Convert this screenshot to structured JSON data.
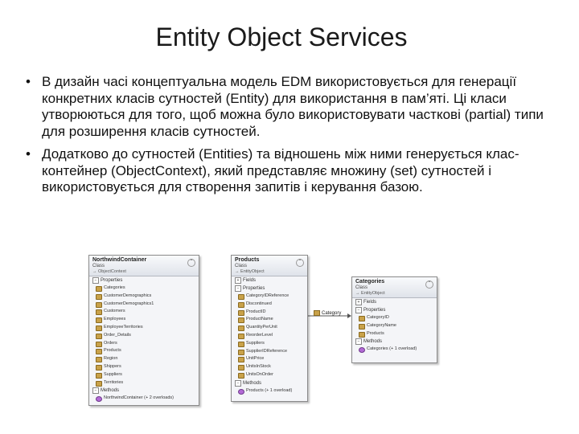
{
  "slide": {
    "title": "Entity Object Services",
    "bullets": [
      "В дизайн часі концептуальна модель EDM використовується для генерації конкретних класів сутностей (Entity) для використання в пам’яті. Ці класи утворюються для того, щоб можна було використовувати часткові (partial) типи для розширення класів сутностей.",
      "Додатково до сутностей (Entities)  та відношень між ними генерується клас-контейнер (ObjectContext), який представляє множину (set) сутностей і використовується для  створення запитів і керування базою."
    ]
  },
  "diagram": {
    "container": {
      "name": "NorthwindContainer",
      "kind": "Class",
      "base": "→ ObjectContext",
      "properties_label": "Properties",
      "methods_label": "Methods",
      "properties": [
        "Categories",
        "CustomerDemographics",
        "CustomerDemographics1",
        "Customers",
        "Employees",
        "EmployeeTerritories",
        "Order_Details",
        "Orders",
        "Products",
        "Region",
        "Shippers",
        "Suppliers",
        "Territories"
      ],
      "methods": [
        "NorthwindContainer (+ 2 overloads)"
      ]
    },
    "products": {
      "name": "Products",
      "kind": "Class",
      "base": "→ EntityObject",
      "fields_label": "Fields",
      "properties_label": "Properties",
      "methods_label": "Methods",
      "properties": [
        "CategoryIDReference",
        "Discontinued",
        "ProductID",
        "ProductName",
        "QuantityPerUnit",
        "ReorderLevel",
        "Suppliers",
        "SupplierIDReference",
        "UnitPrice",
        "UnitsInStock",
        "UnitsOnOrder"
      ],
      "methods": [
        "Products (+ 1 overload)"
      ]
    },
    "categories": {
      "name": "Categories",
      "kind": "Class",
      "base": "→ EntityObject",
      "fields_label": "Fields",
      "properties_label": "Properties",
      "methods_label": "Methods",
      "properties": [
        "CategoryID",
        "CategoryName",
        "Products"
      ],
      "methods": [
        "Categories (+ 1 overload)"
      ]
    },
    "association_label": "Category"
  }
}
